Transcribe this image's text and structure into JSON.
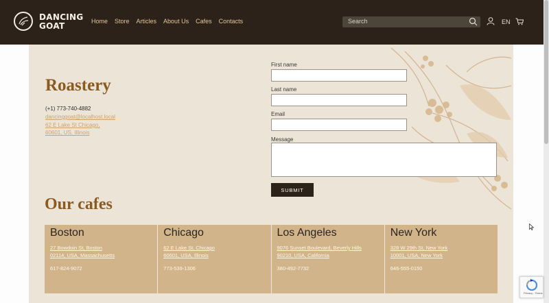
{
  "header": {
    "brand_line1": "DANCING",
    "brand_line2": "GOAT",
    "nav": [
      "Home",
      "Store",
      "Articles",
      "About Us",
      "Cafes",
      "Contacts"
    ],
    "search_placeholder": "Search",
    "language": "EN"
  },
  "roastery": {
    "title": "Roastery",
    "phone": "(+1) 773-740-4882",
    "email": "dancinggoat@localhost.local",
    "address_line1": "62 E Lake St Chicago,",
    "address_line2": "60601, US, Illinois"
  },
  "form": {
    "first_name_label": "First name",
    "last_name_label": "Last name",
    "email_label": "Email",
    "message_label": "Message",
    "first_name_value": "",
    "last_name_value": "",
    "email_value": "",
    "message_value": "",
    "submit_label": "SUBMIT"
  },
  "cafes": {
    "title": "Our cafes",
    "items": [
      {
        "name": "Boston",
        "street": "27 Bowdoin St, Boston",
        "city": "02114, USA, Massachusetts",
        "phone": "617-824-9072"
      },
      {
        "name": "Chicago",
        "street": "62 E Lake St, Chicago",
        "city": "60601, USA, Illinois",
        "phone": "773-539-1306"
      },
      {
        "name": "Los Angeles",
        "street": "9076 Sunset Boulevard, Beverly Hills",
        "city": "90210, USA, California",
        "phone": "380-492-7732"
      },
      {
        "name": "New York",
        "street": "328 W 29th St, New York",
        "city": "10001, USA, New York",
        "phone": "646-555-0150"
      }
    ]
  },
  "recaptcha": {
    "text": "Privacy - Terms"
  },
  "colors": {
    "header_bg": "#2c2219",
    "nav_link": "#e3c79a",
    "heading": "#8a5a1f",
    "content_bg": "#ede4d8",
    "cafe_card": "#d2b48a",
    "button_bg": "#2c2219"
  },
  "icons": [
    "goat-logo-icon",
    "search-icon",
    "user-icon",
    "cart-icon",
    "coffee-plant-decoration",
    "mouse-cursor-icon",
    "recaptcha-icon"
  ]
}
